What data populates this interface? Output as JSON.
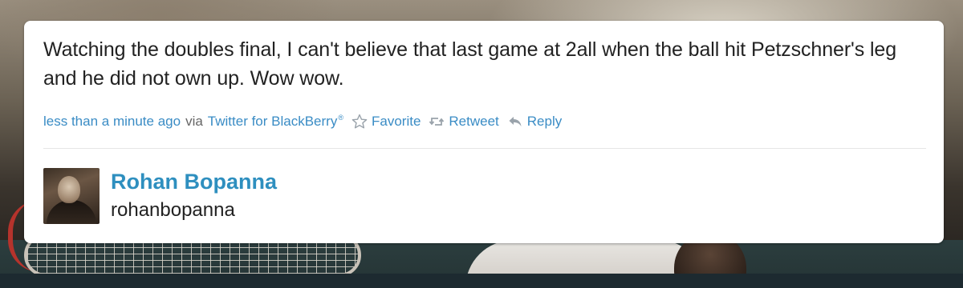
{
  "tweet": {
    "text": "Watching the doubles final, I can't believe that last game at 2all when the ball hit Petzschner's leg and he did not own up. Wow wow.",
    "timestamp": "less than a minute ago",
    "via_label": "via",
    "source": "Twitter for BlackBerry",
    "source_mark": "®",
    "actions": {
      "favorite": "Favorite",
      "retweet": "Retweet",
      "reply": "Reply"
    }
  },
  "user": {
    "name": "Rohan Bopanna",
    "handle": "rohanbopanna"
  },
  "colors": {
    "link": "#3a8cc5",
    "name": "#2e8fbf",
    "text": "#222222"
  },
  "icons": [
    "star-icon",
    "retweet-icon",
    "reply-icon"
  ]
}
